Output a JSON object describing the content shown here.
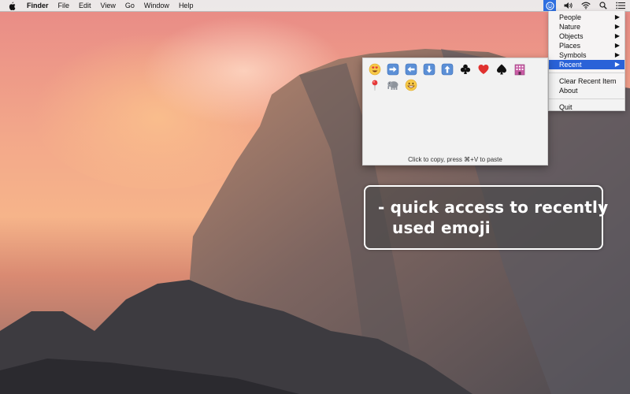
{
  "menubar": {
    "apple_icon": "apple-icon",
    "app_name": "Finder",
    "items": [
      "File",
      "Edit",
      "View",
      "Go",
      "Window",
      "Help"
    ],
    "tray": [
      "emoji-smiley-icon",
      "speaker-icon",
      "wifi-icon",
      "search-icon",
      "list-icon"
    ]
  },
  "dropdown": {
    "categories": [
      {
        "label": "People",
        "has_submenu": true
      },
      {
        "label": "Nature",
        "has_submenu": true
      },
      {
        "label": "Objects",
        "has_submenu": true
      },
      {
        "label": "Places",
        "has_submenu": true
      },
      {
        "label": "Symbols",
        "has_submenu": true
      },
      {
        "label": "Recent",
        "has_submenu": true,
        "selected": true
      }
    ],
    "clear_label": "Clear Recent Item",
    "about_label": "About",
    "quit_label": "Quit",
    "arrow": "▶",
    "selected_color": "#2a62d8"
  },
  "emoji_panel": {
    "emojis": [
      "heart-eyes-icon",
      "right-arrow-icon",
      "left-arrow-icon",
      "down-arrow-icon",
      "up-arrow-icon",
      "club-icon",
      "heart-icon",
      "spade-icon",
      "building-icon",
      "pin-icon",
      "elephant-icon",
      "grinning-face-icon"
    ],
    "hint": "Click to copy, press ⌘+V to paste"
  },
  "caption": {
    "line1": "- quick access to recently",
    "line2": "used emoji"
  }
}
